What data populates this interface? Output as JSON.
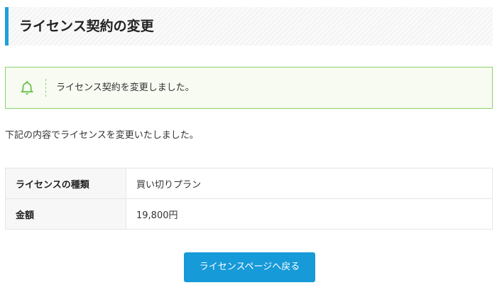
{
  "page": {
    "title": "ライセンス契約の変更",
    "accent_color": "#1ea0dc"
  },
  "notice": {
    "icon": "bell-icon",
    "message": "ライセンス契約を変更しました。",
    "color": "#8dd06a"
  },
  "description": "下記の内容でライセンスを変更いたしました。",
  "details": {
    "rows": [
      {
        "label": "ライセンスの種類",
        "value": "買い切りプラン"
      },
      {
        "label": "金額",
        "value": "19,800円"
      }
    ]
  },
  "actions": {
    "back_label": "ライセンスページへ戻る",
    "button_color": "#169ad8"
  }
}
